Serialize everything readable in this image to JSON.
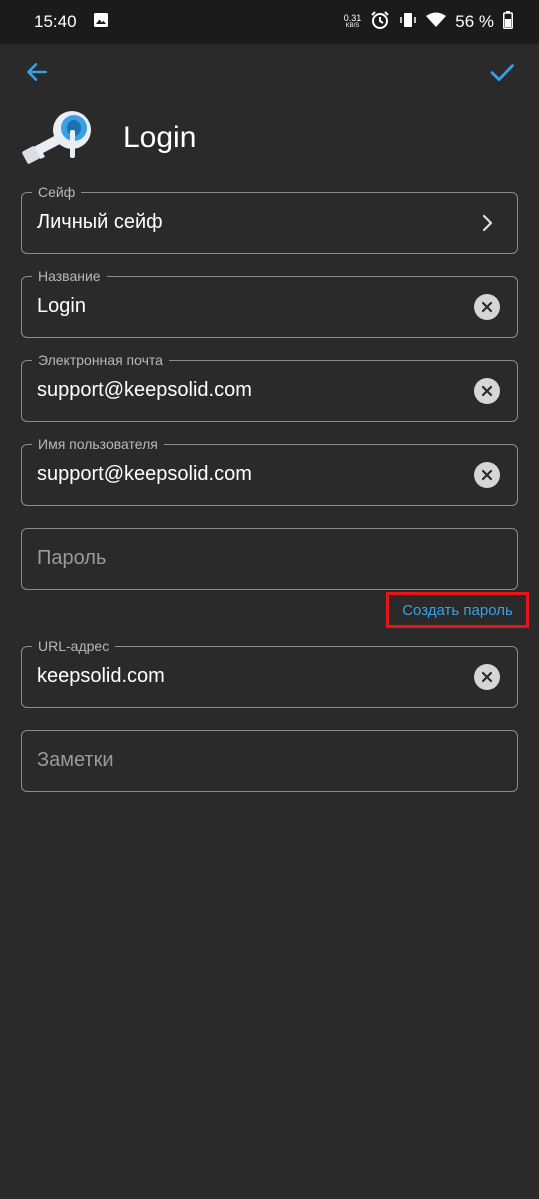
{
  "status_bar": {
    "time": "15:40",
    "net_speed": "0.31",
    "net_unit": "KB/S",
    "battery": "56 %"
  },
  "header": {
    "title": "Login"
  },
  "fields": {
    "vault": {
      "label": "Сейф",
      "value": "Личный сейф"
    },
    "name": {
      "label": "Название",
      "value": "Login"
    },
    "email": {
      "label": "Электронная почта",
      "value": "support@keepsolid.com"
    },
    "username": {
      "label": "Имя пользователя",
      "value": "support@keepsolid.com"
    },
    "password": {
      "placeholder": "Пароль"
    },
    "url": {
      "label": "URL-адрес",
      "value": "keepsolid.com"
    },
    "notes": {
      "placeholder": "Заметки"
    }
  },
  "generate_password_label": "Создать пароль",
  "colors": {
    "accent": "#3aa0e6",
    "background": "#2a2a2a",
    "highlight": "#e8141a"
  },
  "icons": [
    "arrow-back-icon",
    "check-icon",
    "key-icon",
    "chevron-right-icon",
    "clear-icon",
    "image-icon",
    "alarm-icon",
    "vibrate-icon",
    "wifi-icon",
    "battery-icon"
  ]
}
